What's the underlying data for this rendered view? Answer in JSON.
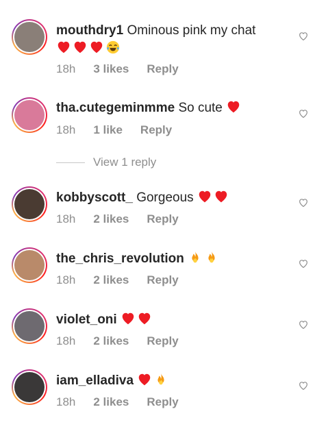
{
  "comments": [
    {
      "username": "mouthdry1",
      "text": "Ominous pink my chat",
      "emojis": [
        "red-heart",
        "red-heart",
        "red-heart",
        "tears-of-joy"
      ],
      "time": "18h",
      "likes": "3 likes",
      "reply": "Reply",
      "avatar_color": "#8a7f78"
    },
    {
      "username": "tha.cutegeminmme",
      "text": "So cute",
      "emojis": [
        "red-heart"
      ],
      "time": "18h",
      "likes": "1 like",
      "reply": "Reply",
      "avatar_color": "#d97a9a"
    },
    {
      "username": "kobbyscott_",
      "text": "Gorgeous",
      "emojis": [
        "red-heart",
        "red-heart"
      ],
      "time": "18h",
      "likes": "2 likes",
      "reply": "Reply",
      "avatar_color": "#4a3b32"
    },
    {
      "username": "the_chris_revolution",
      "text": "",
      "emojis": [
        "fire",
        "fire"
      ],
      "time": "18h",
      "likes": "2 likes",
      "reply": "Reply",
      "avatar_color": "#b98a6a"
    },
    {
      "username": "violet_oni",
      "text": "",
      "emojis": [
        "red-heart",
        "red-heart"
      ],
      "time": "18h",
      "likes": "2 likes",
      "reply": "Reply",
      "avatar_color": "#6e6a70"
    },
    {
      "username": "iam_elladiva",
      "text": "",
      "emojis": [
        "red-heart",
        "fire"
      ],
      "time": "18h",
      "likes": "2 likes",
      "reply": "Reply",
      "avatar_color": "#3a3838"
    }
  ],
  "view_replies": "View 1 reply",
  "colors": {
    "text": "#262626",
    "secondary": "#8e8e8e",
    "heart": "#ed1c24",
    "fire": "#f59a14"
  }
}
